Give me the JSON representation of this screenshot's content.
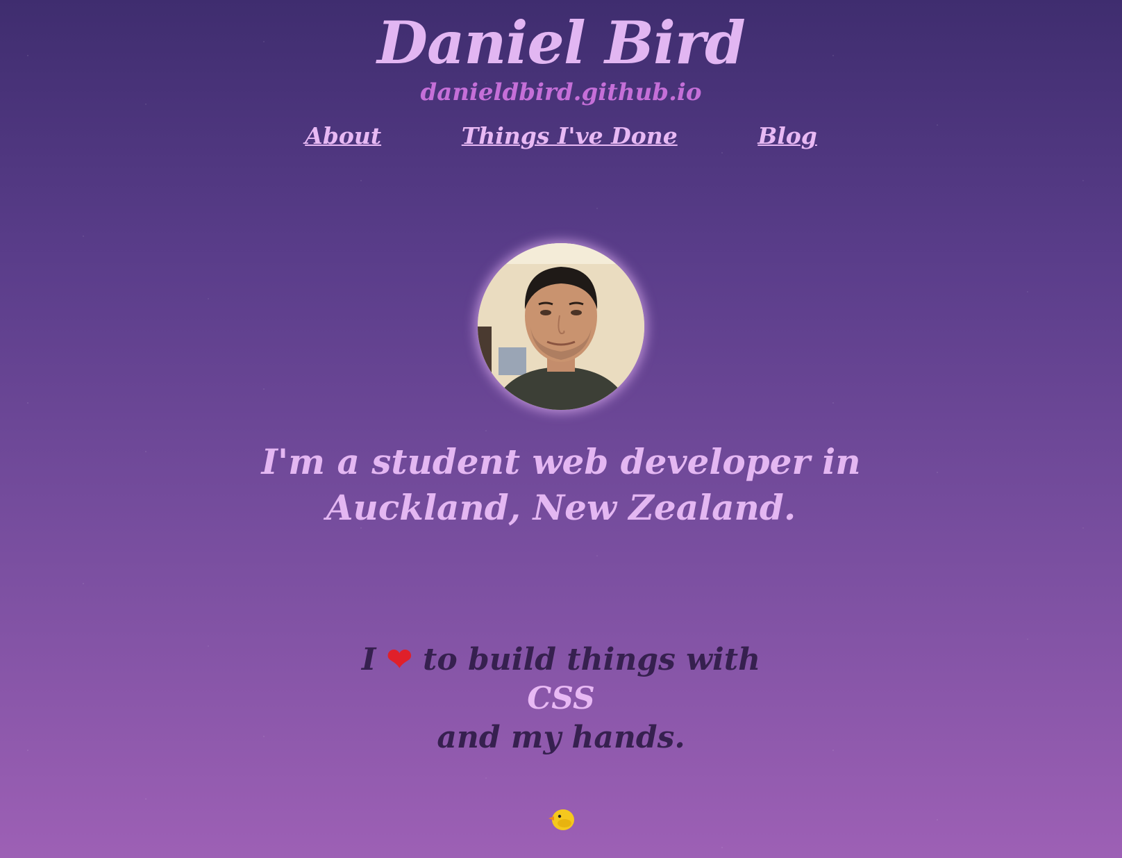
{
  "header": {
    "title": "Daniel Bird",
    "url": "danieldbird.github.io"
  },
  "nav": {
    "items": [
      "About",
      "Things I've Done",
      "Blog"
    ]
  },
  "intro": {
    "line1": "I'm a student web developer in",
    "line2": "Auckland, New Zealand."
  },
  "love": {
    "prefix": "I",
    "heart": "❤",
    "line1_rest": "to build things with",
    "highlight": "CSS",
    "line3": "and my hands."
  },
  "icons": {
    "heart_icon": "heart-icon",
    "chick_icon": "chick-icon",
    "avatar": "profile-photo"
  },
  "colors": {
    "title": "#e2b6f2",
    "url": "#c56fd8",
    "dark_text": "#36204f",
    "heart": "#e0202a"
  }
}
